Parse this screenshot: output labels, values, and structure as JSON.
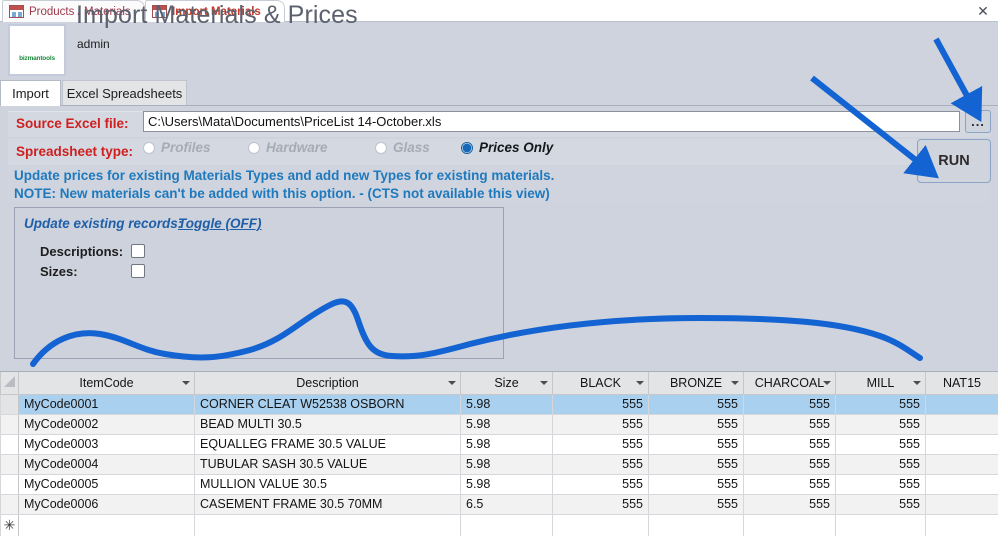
{
  "window": {
    "close_label": "✕",
    "accent_blue": "#1a6fd4",
    "background": "#ced3dd"
  },
  "doc_tabs": [
    {
      "label": "Products / Materials",
      "active": false,
      "icon": "access-form-icon"
    },
    {
      "label": "Import Materials",
      "active": true,
      "icon": "access-form-icon"
    }
  ],
  "header": {
    "title": "Import Materials & Prices",
    "user": "admin",
    "logo_text": "bizmantools"
  },
  "inner_tabs": [
    {
      "label": "Import",
      "active": true
    },
    {
      "label": "Excel Spreadsheets",
      "active": false
    }
  ],
  "form": {
    "source_label": "Source Excel file:",
    "source_value": "C:\\Users\\Mata\\Documents\\PriceList 14-October.xls",
    "source_placeholder": "",
    "browse_label": "...",
    "run_label": "RUN",
    "type_label": "Spreadsheet type:",
    "types": [
      {
        "label": "Profiles",
        "selected": false
      },
      {
        "label": "Hardware",
        "selected": false
      },
      {
        "label": "Glass",
        "selected": false
      },
      {
        "label": "Prices Only",
        "selected": true
      }
    ],
    "note_line1": "Update prices for existing Materials Types and add new Types for existing materials.",
    "note_line2": "NOTE: New materials can't be added with this option. - (CTS not available this view)",
    "note_color": "#1f79bd"
  },
  "panel": {
    "title": "Update existing records:",
    "toggle_label": "Toggle (OFF)",
    "checkboxes": [
      {
        "label": "Descriptions:",
        "checked": false
      },
      {
        "label": "Sizes:",
        "checked": false
      }
    ]
  },
  "datasheet": {
    "columns": [
      "ItemCode",
      "Description",
      "Size",
      "BLACK",
      "BRONZE",
      "CHARCOAL",
      "MILL",
      "NAT15"
    ],
    "rows": [
      {
        "cells": [
          "MyCode0001",
          "CORNER CLEAT W52538 OSBORN",
          "5.98",
          "555",
          "555",
          "555",
          "555",
          ""
        ],
        "selected": true
      },
      {
        "cells": [
          "MyCode0002",
          "BEAD MULTI 30.5",
          "5.98",
          "555",
          "555",
          "555",
          "555",
          ""
        ],
        "selected": false
      },
      {
        "cells": [
          "MyCode0003",
          "EQUALLEG FRAME 30.5 VALUE",
          "5.98",
          "555",
          "555",
          "555",
          "555",
          ""
        ],
        "selected": false
      },
      {
        "cells": [
          "MyCode0004",
          "TUBULAR SASH 30.5 VALUE",
          "5.98",
          "555",
          "555",
          "555",
          "555",
          ""
        ],
        "selected": false
      },
      {
        "cells": [
          "MyCode0005",
          "MULLION VALUE 30.5",
          "5.98",
          "555",
          "555",
          "555",
          "555",
          ""
        ],
        "selected": false
      },
      {
        "cells": [
          "MyCode0006",
          "CASEMENT FRAME 30.5 70MM",
          "6.5",
          "555",
          "555",
          "555",
          "555",
          ""
        ],
        "selected": false
      }
    ],
    "new_row_marker": "✳"
  },
  "annotations": {
    "arrow1_target": "browse-button",
    "arrow2_target": "run-button",
    "squiggle": "hand-drawn-wave",
    "color": "#1463d2"
  }
}
